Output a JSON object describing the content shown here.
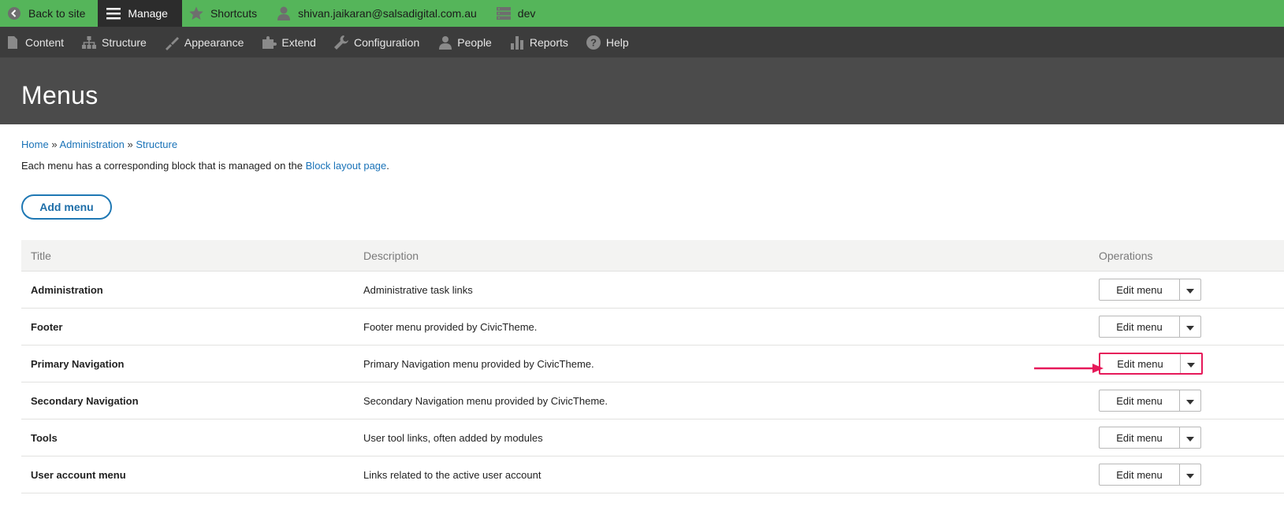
{
  "toolbar": {
    "back": "Back to site",
    "manage": "Manage",
    "shortcuts": "Shortcuts",
    "user": "shivan.jaikaran@salsadigital.com.au",
    "env": "dev"
  },
  "tray": {
    "items": [
      "Content",
      "Structure",
      "Appearance",
      "Extend",
      "Configuration",
      "People",
      "Reports",
      "Help"
    ]
  },
  "page": {
    "title": "Menus"
  },
  "breadcrumb": {
    "items": [
      "Home",
      "Administration",
      "Structure"
    ],
    "separator": "»"
  },
  "help": {
    "prefix": "Each menu has a corresponding block that is managed on the",
    "link": "Block layout page",
    "suffix": "."
  },
  "add_menu_label": "Add menu",
  "table": {
    "headers": {
      "title": "Title",
      "description": "Description",
      "operations": "Operations"
    },
    "rows": [
      {
        "title": "Administration",
        "description": "Administrative task links",
        "op": "Edit menu"
      },
      {
        "title": "Footer",
        "description": "Footer menu provided by CivicTheme.",
        "op": "Edit menu"
      },
      {
        "title": "Primary Navigation",
        "description": "Primary Navigation menu provided by CivicTheme.",
        "op": "Edit menu"
      },
      {
        "title": "Secondary Navigation",
        "description": "Secondary Navigation menu provided by CivicTheme.",
        "op": "Edit menu"
      },
      {
        "title": "Tools",
        "description": "User tool links, often added by modules",
        "op": "Edit menu"
      },
      {
        "title": "User account menu",
        "description": "Links related to the active user account",
        "op": "Edit menu"
      }
    ]
  },
  "colors": {
    "toolbar": "#55b55a",
    "tray": "#3c3c3c",
    "header": "#4b4b4b",
    "link": "#1a73b8",
    "highlight": "#e6195a"
  }
}
